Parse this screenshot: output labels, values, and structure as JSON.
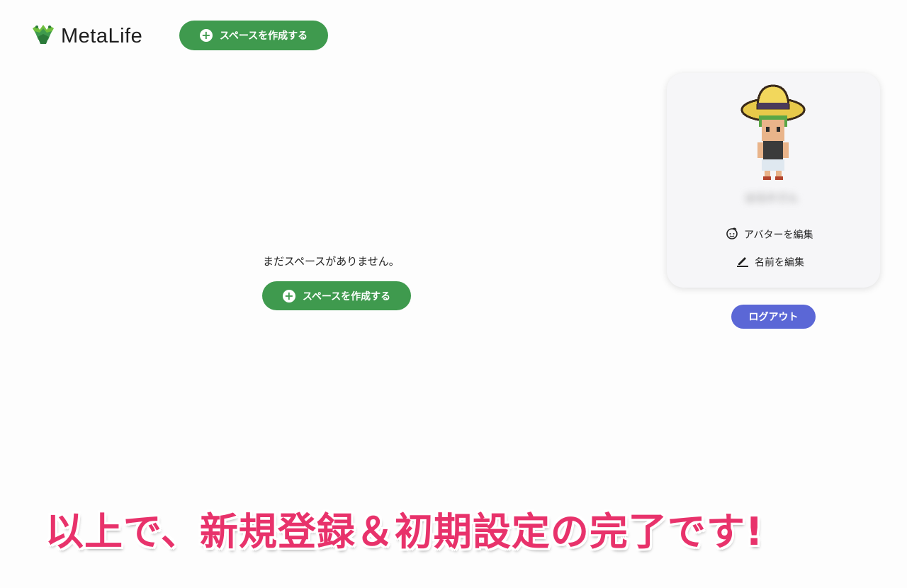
{
  "header": {
    "brand": "MetaLife",
    "create_space_label": "スペースを作成する"
  },
  "main": {
    "empty_message": "まだスペースがありません。",
    "create_space_label": "スペースを作成する"
  },
  "profile": {
    "username": "はるかさん",
    "edit_avatar_label": "アバターを編集",
    "edit_name_label": "名前を編集",
    "logout_label": "ログアウト"
  },
  "caption": {
    "text": "以上で、新規登録＆初期設定の完了です!"
  },
  "colors": {
    "brand_green": "#3f9a4e",
    "logout_purple": "#5b67d6",
    "caption_pink": "#e8326b"
  },
  "icons": {
    "plus": "plus-circle-icon",
    "avatar_edit": "face-icon",
    "name_edit": "pencil-icon",
    "logo": "metalife-logo-icon"
  }
}
